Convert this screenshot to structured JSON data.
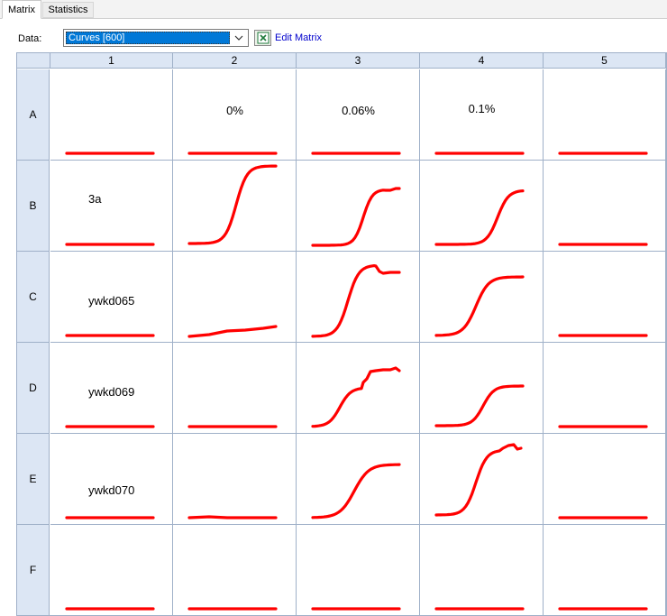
{
  "tabs": [
    {
      "label": "Matrix",
      "active": true
    },
    {
      "label": "Statistics",
      "active": false
    }
  ],
  "toolbar": {
    "data_label": "Data:",
    "selected_value": "Curves [600]",
    "excel_icon": "excel-icon",
    "edit_link": "Edit Matrix"
  },
  "matrix": {
    "columns": [
      "1",
      "2",
      "3",
      "4",
      "5"
    ],
    "rows": [
      "A",
      "B",
      "C",
      "D",
      "E",
      "F"
    ],
    "cell_labels": {
      "A2": "0%",
      "A3": "0.06%",
      "A4": "0.1%",
      "B1": "3a",
      "C1": "ywkd065",
      "D1": "ywkd069",
      "E1": "ywkd070"
    },
    "curve_color": "#ff0000",
    "header_bg": "#dce6f4",
    "border_color": "#9fb0c8"
  }
}
